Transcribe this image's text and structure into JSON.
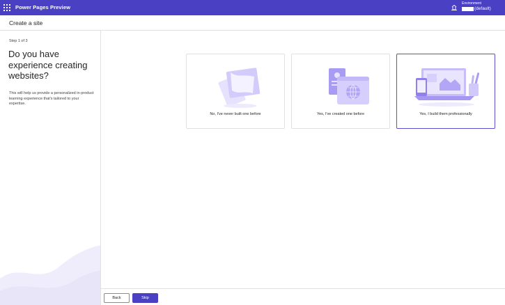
{
  "topbar": {
    "app_title": "Power Pages Preview",
    "environment_label": "Environment",
    "environment_value": "(default)"
  },
  "subheader": {
    "title": "Create a site"
  },
  "left_panel": {
    "step": "Step 1 of 3",
    "question": "Do you have experience creating websites?",
    "description": "This will help us provide a personalized in-product learning experience that's tailored to your expertise."
  },
  "options": [
    {
      "label": "No, I've never built one before",
      "selected": false,
      "icon": "paper-sheets-icon"
    },
    {
      "label": "Yes, I've created one before",
      "selected": false,
      "icon": "web-pages-globe-icon"
    },
    {
      "label": "Yes, I build them professionally",
      "selected": true,
      "icon": "laptop-devices-icon"
    }
  ],
  "footer": {
    "back_label": "Back",
    "skip_label": "Skip"
  },
  "colors": {
    "brand": "#4a40c4",
    "accent_light": "#d9d3fb",
    "selected_border": "#5b4fd0"
  }
}
